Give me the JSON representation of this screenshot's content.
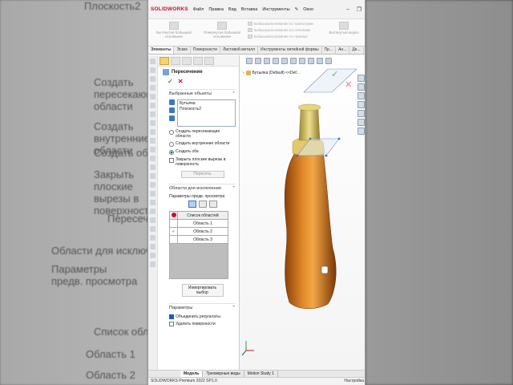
{
  "background": {
    "texts": [
      "Плоскость2",
      "Создать пересекающие области",
      "Создать внутренние области",
      "Создать оба",
      "Закрыть плоские вырезы в поверхности",
      "Пересечь",
      "Области для исключения",
      "Параметры предв. просмотра",
      "Список областей",
      "Область 1",
      "Область 2",
      "Область 3"
    ]
  },
  "app": {
    "logo": "SOLIDWORKS",
    "menu": [
      "Файл",
      "Правка",
      "Вид",
      "Вставка",
      "Инструменты",
      "Окно"
    ],
    "ribbon": {
      "big_buttons": [
        "Вытянутая бобышка/основание",
        "Повернутая бобышка/основание"
      ],
      "lines": [
        "Бобышка/основание по траектории",
        "Бобышка/основание по сечениям",
        "Бобышка/основание по границе"
      ],
      "extra": [
        "Вытянутый вырез",
        "Повернутый вырез"
      ]
    },
    "tabs": [
      "Элементы",
      "Эскиз",
      "Поверхности",
      "Листовой металл",
      "Инструменты литейной формы",
      "Пр...",
      "Ан...",
      "Де..."
    ],
    "tree_label": "Бутылка (Default) <<Def...",
    "panel": {
      "title": "Пересечение",
      "selected_header": "Выбранные объекты",
      "selected_items": [
        "Бутылка",
        "Плоскость2"
      ],
      "options": [
        {
          "label": "Создать пересекающие области",
          "selected": false
        },
        {
          "label": "Создать внутренние области",
          "selected": false
        },
        {
          "label": "Создать оба",
          "selected": true
        }
      ],
      "close_flat": {
        "label": "Закрыть плоские вырезы в поверхность",
        "checked": false
      },
      "intersect_button": "Пересечь",
      "exclude_header": "Области для исключения",
      "preview_label": "Параметры предв. просмотра",
      "table_header": "Список областей",
      "regions": [
        {
          "name": "Область 1",
          "checked": false
        },
        {
          "name": "Область 2",
          "checked": true
        },
        {
          "name": "Область 3",
          "checked": false
        }
      ],
      "invert_button": "Инвертировать выбор",
      "params_header": "Параметры",
      "merge_results": {
        "label": "Объединить результаты",
        "checked": true
      },
      "delete_surfaces": {
        "label": "Удалить поверхности",
        "checked": false
      }
    },
    "bottom_tabs": [
      "Модель",
      "Трехмерные виды",
      "Motion Study 1"
    ],
    "status_left": "SOLIDWORKS Premium 2022 SP1.0",
    "status_right": "Настройка",
    "colors": {
      "bottle": "#d2741f",
      "neck": "#d9c36a",
      "accent": "#c8102e"
    }
  }
}
